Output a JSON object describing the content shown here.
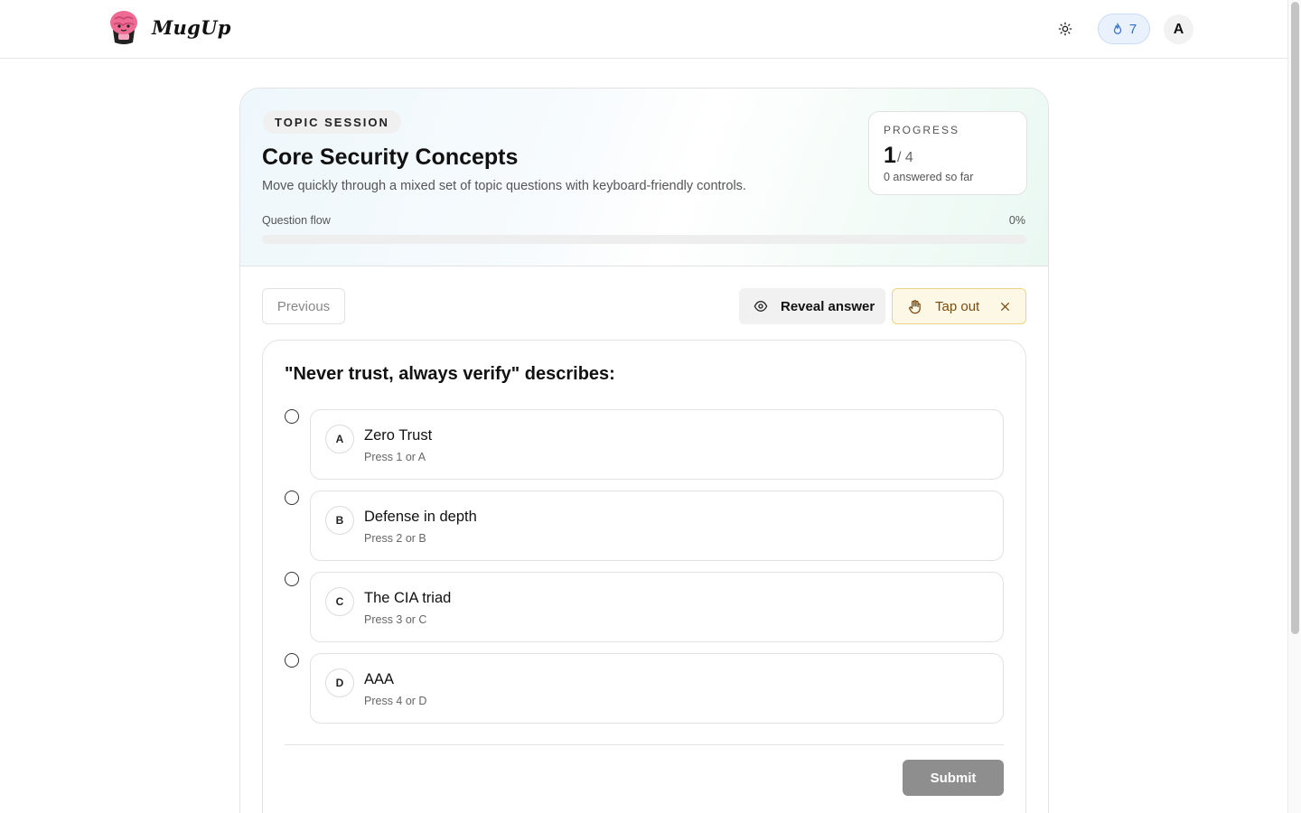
{
  "header": {
    "brand": "MugUp",
    "streak_count": "7",
    "avatar_initial": "A"
  },
  "session": {
    "chip": "TOPIC SESSION",
    "title": "Core Security Concepts",
    "subtitle": "Move quickly through a mixed set of topic questions with keyboard-friendly controls.",
    "progress_label": "PROGRESS",
    "progress_current": "1",
    "progress_total": "/ 4",
    "progress_note": "0 answered so far",
    "flow_label": "Question flow",
    "flow_percent_text": "0%",
    "flow_percent": 0
  },
  "controls": {
    "previous_label": "Previous",
    "reveal_label": "Reveal answer",
    "tapout_label": "Tap out"
  },
  "question": {
    "text": "\"Never trust, always verify\" describes:",
    "options": [
      {
        "letter": "A",
        "text": "Zero Trust",
        "hint": "Press 1 or A"
      },
      {
        "letter": "B",
        "text": "Defense in depth",
        "hint": "Press 2 or B"
      },
      {
        "letter": "C",
        "text": "The CIA triad",
        "hint": "Press 3 or C"
      },
      {
        "letter": "D",
        "text": "AAA",
        "hint": "Press 4 or D"
      }
    ],
    "submit_label": "Submit"
  },
  "icons": {
    "logo": "brain-mug-logo-icon",
    "theme": "sun-icon",
    "streak": "flame-icon",
    "reveal": "eye-icon",
    "tapout": "hand-icon",
    "close": "close-icon"
  },
  "colors": {
    "accent_blue": "#2f6fcf",
    "tapout_bg": "#fdf8e6",
    "tapout_border": "#ebd485",
    "submit_disabled": "#8e8e8e"
  }
}
